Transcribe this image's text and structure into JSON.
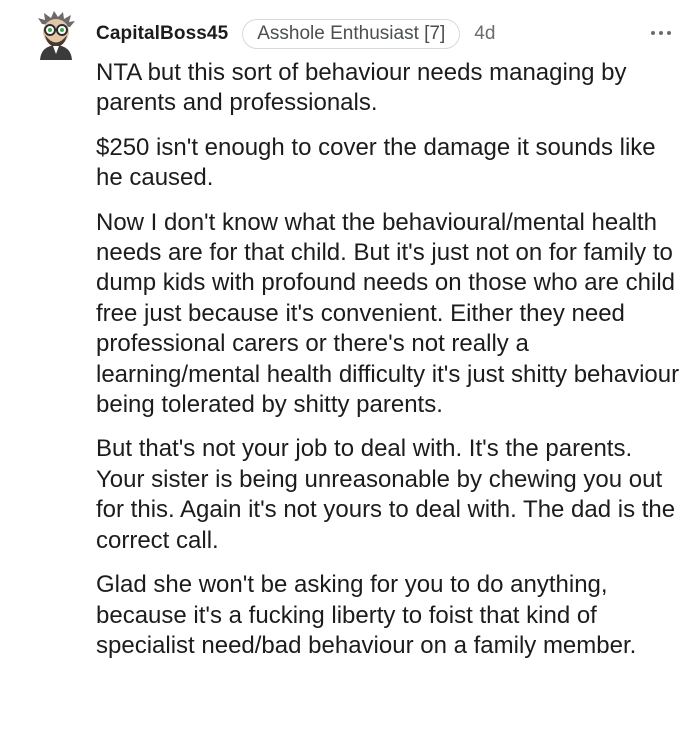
{
  "comment": {
    "author": "CapitalBoss45",
    "flair": "Asshole Enthusiast [7]",
    "age": "4d",
    "paragraphs": [
      "NTA but this sort of behaviour needs managing by parents and professionals.",
      "$250 isn't enough to cover the damage it sounds like he caused.",
      "Now I don't know what the behavioural/mental health needs are for that child. But it's just not on for family to dump kids with profound needs on those who are child free just because it's convenient. Either they need professional carers or there's not really a learning/mental health difficulty it's just shitty behaviour being tolerated by shitty parents.",
      "But that's not your job to deal with. It's the parents. Your sister is being unreasonable by chewing you out for this. Again it's not yours to deal with. The dad is the correct call.",
      "Glad she won't be asking for you to do anything, because it's a fucking liberty to foist that kind of specialist need/bad behaviour on a family member."
    ]
  },
  "icons": {
    "avatar": "avatar-icon",
    "more": "more-options-icon"
  }
}
